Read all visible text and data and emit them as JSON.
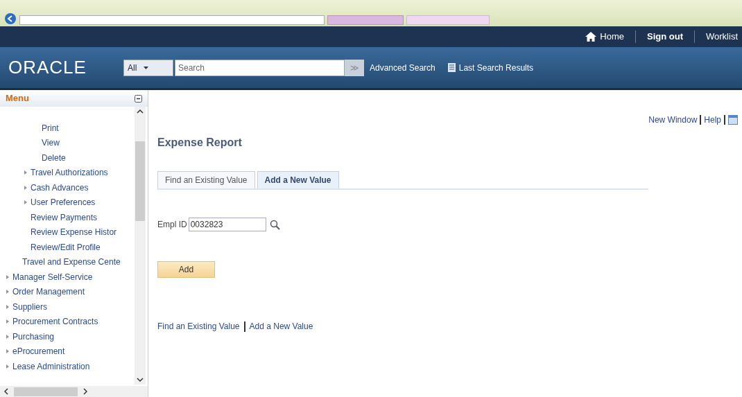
{
  "top_nav": [
    {
      "kind": "home",
      "label": "Home"
    },
    {
      "kind": "bold",
      "label": "Sign out"
    },
    {
      "kind": "plain",
      "label": "Worklist"
    }
  ],
  "header": {
    "logo": "ORACLE",
    "scope": "All",
    "search_placeholder": "Search",
    "go": "≫",
    "advanced": "Advanced Search",
    "last": "Last Search Results"
  },
  "menu": {
    "title": "Menu",
    "items": [
      {
        "children": [
          {
            "children": [
              {
                "children": [
                  {
                    "label": "Print",
                    "collapsed": false
                  },
                  {
                    "label": "View",
                    "collapsed": false
                  },
                  {
                    "label": "Delete",
                    "collapsed": false
                  }
                ]
              },
              {
                "label": "Travel Authorizations",
                "collapsed": true
              },
              {
                "label": "Cash Advances",
                "collapsed": true
              },
              {
                "label": "User Preferences",
                "collapsed": true
              },
              {
                "label": "Review Payments",
                "collapsed": false
              },
              {
                "label": "Review Expense Histor",
                "collapsed": false
              },
              {
                "label": "Review/Edit Profile",
                "collapsed": false
              }
            ]
          },
          {
            "label": "Travel and Expense Cente",
            "collapsed": false
          }
        ]
      },
      {
        "label": "Manager Self-Service",
        "collapsed": true
      },
      {
        "label": "Order Management",
        "collapsed": true
      },
      {
        "label": "Suppliers",
        "collapsed": true
      },
      {
        "label": "Procurement Contracts",
        "collapsed": true
      },
      {
        "label": "Purchasing",
        "collapsed": true
      },
      {
        "label": "eProcurement",
        "collapsed": true
      },
      {
        "label": "Lease Administration",
        "collapsed": true
      }
    ]
  },
  "page_links": [
    "New Window",
    "Help"
  ],
  "title": "Expense Report",
  "tabs": [
    {
      "label": "Find an Existing Value",
      "selected": false
    },
    {
      "label": "Add a New Value",
      "selected": true
    }
  ],
  "field": {
    "label": "Empl ID",
    "value": "0032823"
  },
  "add_button": "Add",
  "bottom_links": [
    "Find an Existing Value",
    "Add a New Value"
  ]
}
